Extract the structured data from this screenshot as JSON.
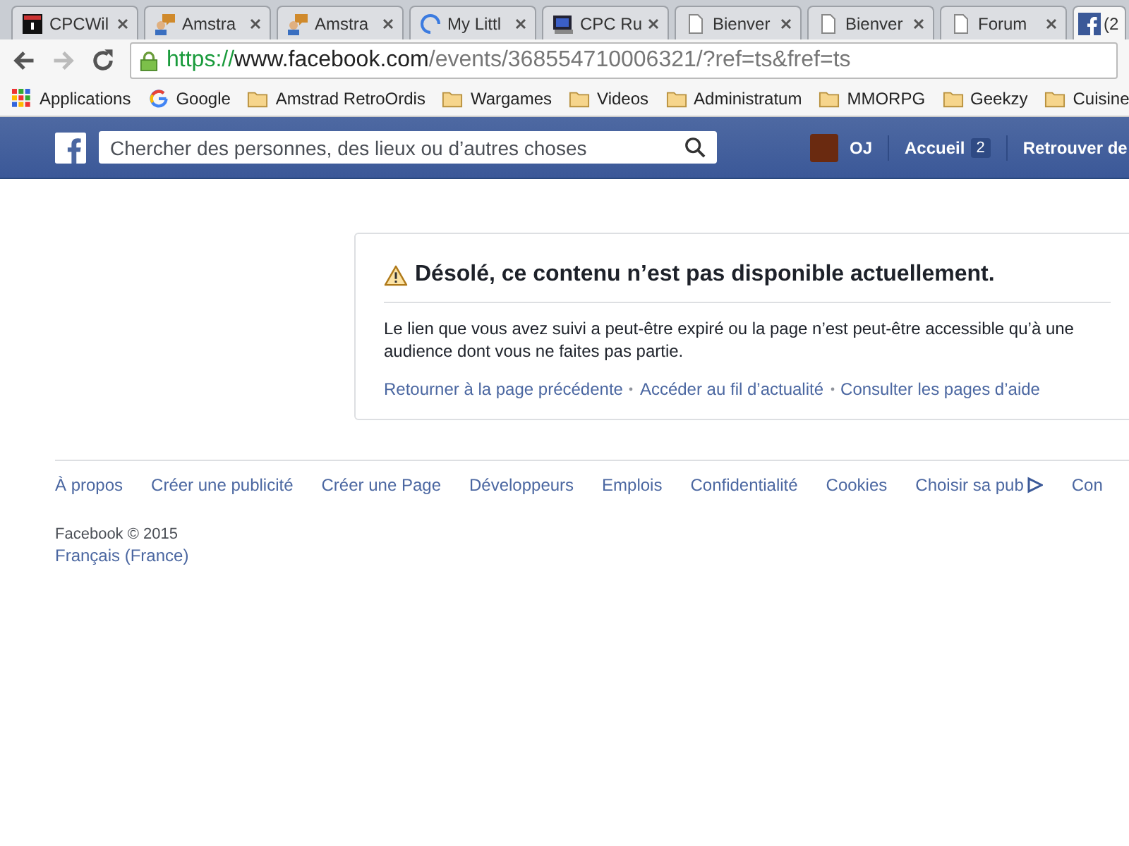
{
  "tabs": [
    {
      "title": "CPCWil",
      "kind": "cpcwiki",
      "selected": false
    },
    {
      "title": "Amstra",
      "kind": "amstrad",
      "selected": false
    },
    {
      "title": "Amstra",
      "kind": "amstrad",
      "selected": false
    },
    {
      "title": "My Littl",
      "kind": "loading",
      "selected": false
    },
    {
      "title": "CPC Ru",
      "kind": "cpc",
      "selected": false
    },
    {
      "title": "Bienver",
      "kind": "page",
      "selected": false
    },
    {
      "title": "Bienver",
      "kind": "page",
      "selected": false
    },
    {
      "title": "Forum",
      "kind": "page",
      "selected": false
    },
    {
      "title": "(2",
      "kind": "facebook",
      "selected": true
    }
  ],
  "address_bar": {
    "scheme": "https://",
    "host": "www.facebook.com",
    "path": "/events/368554710006321/?ref=ts&fref=ts"
  },
  "bookmarks": [
    {
      "label": "Applications",
      "kind": "apps"
    },
    {
      "label": "Google",
      "kind": "google"
    },
    {
      "label": "Amstrad RetroOrdis",
      "kind": "folder"
    },
    {
      "label": "Wargames",
      "kind": "folder"
    },
    {
      "label": "Videos",
      "kind": "folder"
    },
    {
      "label": "Administratum",
      "kind": "folder"
    },
    {
      "label": "MMORPG",
      "kind": "folder"
    },
    {
      "label": "Geekzy",
      "kind": "folder"
    },
    {
      "label": "Cuisine",
      "kind": "folder"
    }
  ],
  "header": {
    "search": {
      "placeholder": "Chercher des personnes, des lieux ou d’autres choses"
    },
    "user": "OJ",
    "home": {
      "label": "Accueil",
      "count": "2"
    },
    "find_friends": "Retrouver de"
  },
  "error": {
    "title": "Désolé, ce contenu n’est pas disponible actuellement.",
    "message": "Le lien que vous avez suivi a peut-être expiré ou la page n’est peut-être accessible qu’à une audience dont vous ne faites pas partie.",
    "links": [
      "Retourner à la page précédente",
      "Accéder au fil d’actualité",
      "Consulter les pages d’aide"
    ]
  },
  "footer": {
    "links": [
      "À propos",
      "Créer une publicité",
      "Créer une Page",
      "Développeurs",
      "Emplois",
      "Confidentialité",
      "Cookies",
      "Choisir sa pub",
      "Con"
    ],
    "copyright": "Facebook © 2015",
    "language": "Français (France)"
  }
}
